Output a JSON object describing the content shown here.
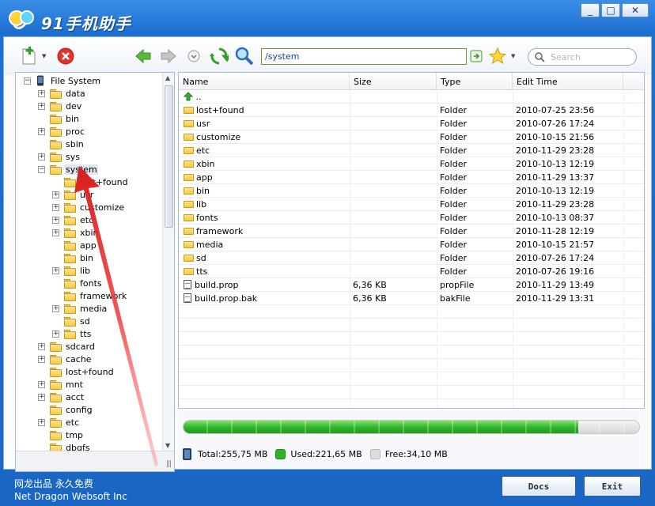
{
  "app": {
    "title": "91手机助手"
  },
  "window": {
    "minimize": "_",
    "maximize": "□",
    "close": "✕"
  },
  "toolbar": {
    "address": "/system",
    "search_placeholder": "Search"
  },
  "tree": {
    "root": "File System",
    "items": [
      {
        "label": "data",
        "expander": true,
        "level": 1
      },
      {
        "label": "dev",
        "expander": true,
        "level": 1
      },
      {
        "label": "bin",
        "expander": false,
        "level": 1
      },
      {
        "label": "proc",
        "expander": true,
        "level": 1
      },
      {
        "label": "sbin",
        "expander": false,
        "level": 1
      },
      {
        "label": "sys",
        "expander": true,
        "level": 1
      },
      {
        "label": "system",
        "expander": "open",
        "level": 1,
        "selected": true
      },
      {
        "label": "lost+found",
        "expander": false,
        "level": 2
      },
      {
        "label": "usr",
        "expander": true,
        "level": 2
      },
      {
        "label": "customize",
        "expander": true,
        "level": 2
      },
      {
        "label": "etc",
        "expander": true,
        "level": 2
      },
      {
        "label": "xbin",
        "expander": true,
        "level": 2
      },
      {
        "label": "app",
        "expander": false,
        "level": 2
      },
      {
        "label": "bin",
        "expander": false,
        "level": 2
      },
      {
        "label": "lib",
        "expander": true,
        "level": 2
      },
      {
        "label": "fonts",
        "expander": false,
        "level": 2
      },
      {
        "label": "framework",
        "expander": false,
        "level": 2
      },
      {
        "label": "media",
        "expander": true,
        "level": 2
      },
      {
        "label": "sd",
        "expander": false,
        "level": 2
      },
      {
        "label": "tts",
        "expander": true,
        "level": 2
      },
      {
        "label": "sdcard",
        "expander": true,
        "level": 1
      },
      {
        "label": "cache",
        "expander": true,
        "level": 1
      },
      {
        "label": "lost+found",
        "expander": false,
        "level": 1
      },
      {
        "label": "mnt",
        "expander": true,
        "level": 1
      },
      {
        "label": "acct",
        "expander": true,
        "level": 1
      },
      {
        "label": "config",
        "expander": false,
        "level": 1
      },
      {
        "label": "etc",
        "expander": true,
        "level": 1
      },
      {
        "label": "tmp",
        "expander": false,
        "level": 1
      },
      {
        "label": "dbgfs",
        "expander": false,
        "level": 1
      }
    ]
  },
  "list": {
    "columns": [
      "Name",
      "Size",
      "Type",
      "Edit Time"
    ],
    "up": "..",
    "rows": [
      {
        "name": "lost+found",
        "size": "",
        "type": "Folder",
        "time": "2010-07-25 23:56",
        "icon": "folder"
      },
      {
        "name": "usr",
        "size": "",
        "type": "Folder",
        "time": "2010-07-26 17:24",
        "icon": "folder"
      },
      {
        "name": "customize",
        "size": "",
        "type": "Folder",
        "time": "2010-10-15 21:56",
        "icon": "folder"
      },
      {
        "name": "etc",
        "size": "",
        "type": "Folder",
        "time": "2010-11-29 23:28",
        "icon": "folder"
      },
      {
        "name": "xbin",
        "size": "",
        "type": "Folder",
        "time": "2010-10-13 12:19",
        "icon": "folder"
      },
      {
        "name": "app",
        "size": "",
        "type": "Folder",
        "time": "2010-11-29 13:37",
        "icon": "folder"
      },
      {
        "name": "bin",
        "size": "",
        "type": "Folder",
        "time": "2010-10-13 12:19",
        "icon": "folder"
      },
      {
        "name": "lib",
        "size": "",
        "type": "Folder",
        "time": "2010-11-29 23:28",
        "icon": "folder"
      },
      {
        "name": "fonts",
        "size": "",
        "type": "Folder",
        "time": "2010-10-13 08:37",
        "icon": "folder"
      },
      {
        "name": "framework",
        "size": "",
        "type": "Folder",
        "time": "2010-11-28 12:19",
        "icon": "folder"
      },
      {
        "name": "media",
        "size": "",
        "type": "Folder",
        "time": "2010-10-15 21:57",
        "icon": "folder"
      },
      {
        "name": "sd",
        "size": "",
        "type": "Folder",
        "time": "2010-07-26 17:24",
        "icon": "folder"
      },
      {
        "name": "tts",
        "size": "",
        "type": "Folder",
        "time": "2010-07-26 19:16",
        "icon": "folder"
      },
      {
        "name": "build.prop",
        "size": "6,36 KB",
        "type": "propFile",
        "time": "2010-11-29 13:49",
        "icon": "file"
      },
      {
        "name": "build.prop.bak",
        "size": "6,36 KB",
        "type": "bakFile",
        "time": "2010-11-29 13:31",
        "icon": "file"
      }
    ]
  },
  "storage": {
    "total": "Total:255,75 MB",
    "used": "Used:221,65 MB",
    "free": "Free:34,10 MB",
    "used_fraction": 0.867,
    "used_color": "#2fb32a",
    "free_color": "#d8d8d8"
  },
  "footer": {
    "line1": "网龙出品 永久免费",
    "line2": "Net Dragon Websoft Inc",
    "docs_button": "Docs",
    "exit_button": "Exit"
  }
}
